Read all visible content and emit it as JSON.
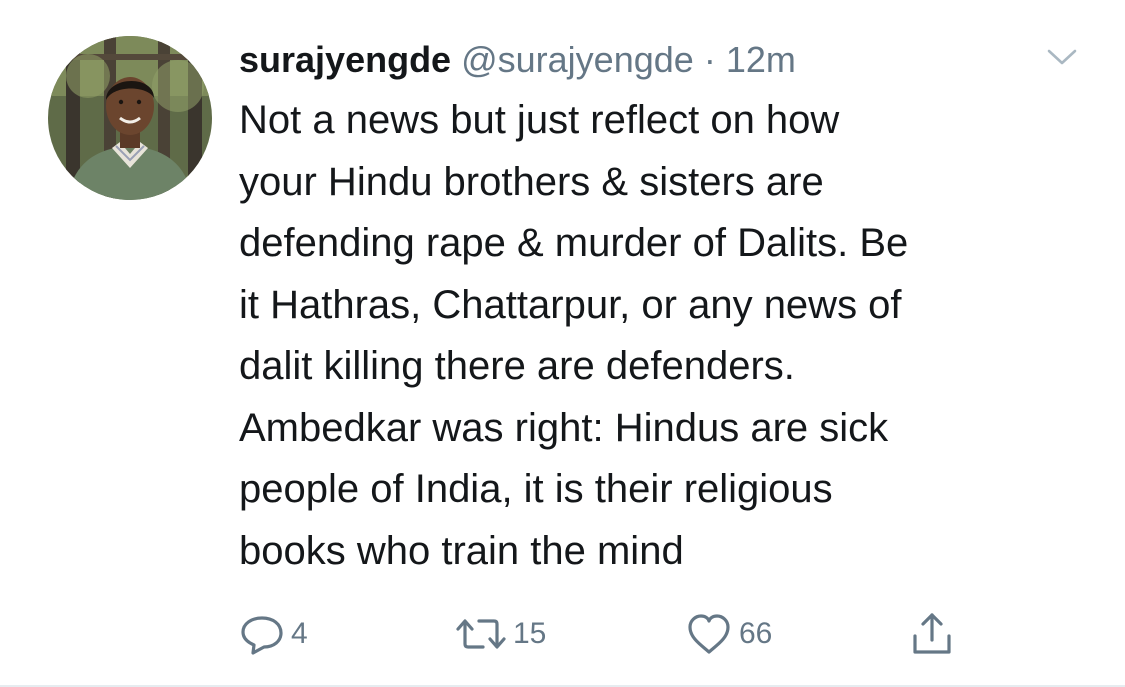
{
  "tweet": {
    "display_name": "surajyengde",
    "handle": "@surajyengde",
    "separator": "·",
    "time": "12m",
    "text": "Not a news but just reflect on how\nyour Hindu brothers & sisters are\ndefending rape & murder of Dalits. Be\nit Hathras, Chattarpur, or any news of\ndalit killing there are defenders.\nAmbedkar was right: Hindus are sick\npeople of India, it is their religious\nbooks who train the mind",
    "actions": {
      "reply_count": "4",
      "retweet_count": "15",
      "like_count": "66"
    }
  },
  "icons": {
    "avatar": "profile-photo",
    "caret": "chevron-down-icon",
    "reply": "reply-icon",
    "retweet": "retweet-icon",
    "like": "heart-icon",
    "share": "share-icon"
  },
  "colors": {
    "text": "#14171a",
    "secondary": "#657786",
    "divider": "#e6ecf0"
  }
}
